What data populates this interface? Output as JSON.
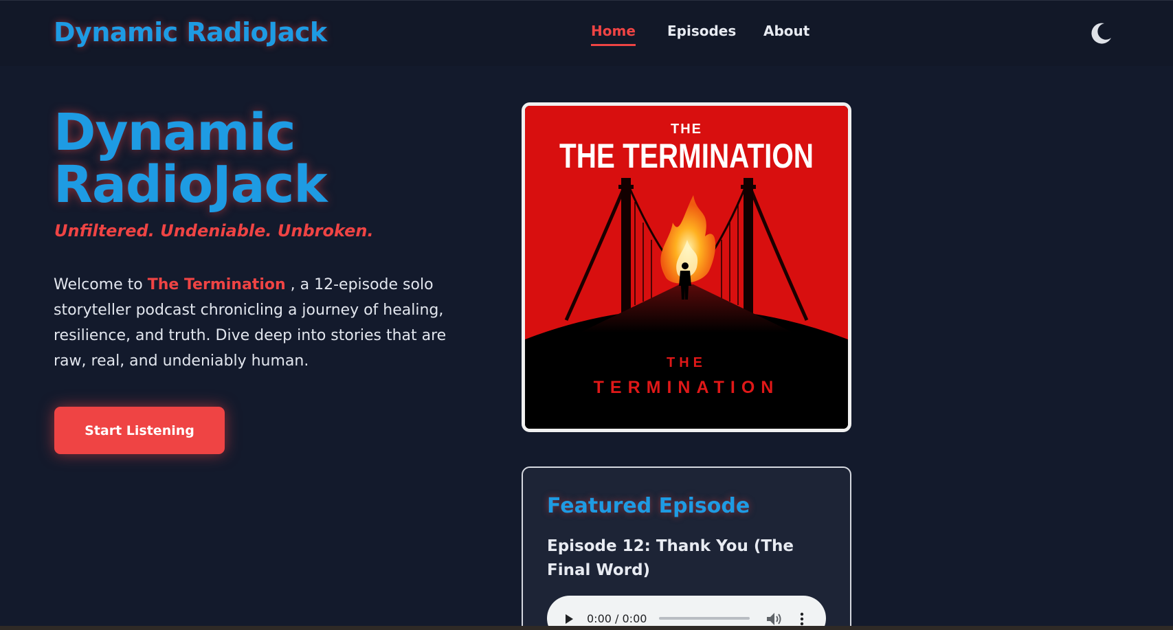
{
  "site": {
    "logo": "Dynamic RadioJack"
  },
  "nav": {
    "items": [
      {
        "label": "Home",
        "active": true
      },
      {
        "label": "Episodes",
        "active": false
      },
      {
        "label": "About",
        "active": false
      }
    ],
    "theme_toggle_icon": "moon-icon"
  },
  "hero": {
    "title": "Dynamic RadioJack",
    "tagline": "Unfiltered. Undeniable. Unbroken.",
    "intro_before": "Welcome to ",
    "intro_highlight": "The Termination",
    "intro_after": " , a 12-episode solo storyteller podcast chronicling a journey of healing, resilience, and truth. Dive deep into stories that are raw, real, and undeniably human.",
    "cta_label": "Start Listening"
  },
  "cover": {
    "top_small": "THE",
    "top_title": "THE TERMINATION",
    "bottom_small": "THE",
    "bottom_title": "TERMINATION"
  },
  "featured": {
    "heading": "Featured Episode",
    "episode_title": "Episode 12: Thank You (The Final Word)",
    "player_time": "0:00 / 0:00"
  },
  "colors": {
    "background": "#131a2c",
    "accent_blue": "#1e9be3",
    "accent_red": "#ef4444"
  }
}
